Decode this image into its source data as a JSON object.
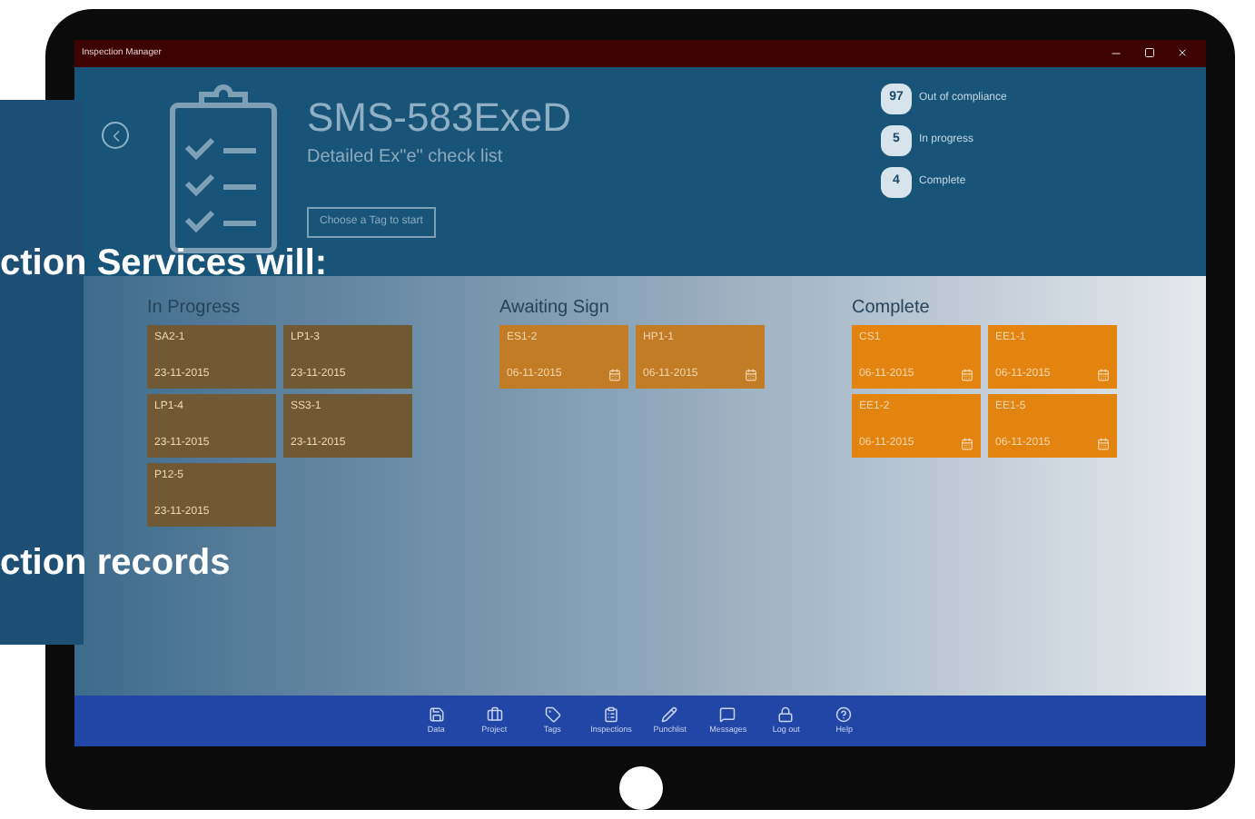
{
  "window": {
    "title": "Inspection Manager"
  },
  "header": {
    "title": "SMS-583ExeD",
    "subtitle": "Detailed Ex\"e\" check list",
    "button": "Choose a Tag to start"
  },
  "stats": [
    {
      "count": "97",
      "label": "Out of compliance"
    },
    {
      "count": "5",
      "label": "In progress"
    },
    {
      "count": "4",
      "label": "Complete"
    }
  ],
  "columns": [
    {
      "title": "In Progress",
      "kind": "in_progress",
      "tiles": [
        {
          "name": "SA2-1",
          "date": "23-11-2015"
        },
        {
          "name": "LP1-3",
          "date": "23-11-2015"
        },
        {
          "name": "LP1-4",
          "date": "23-11-2015"
        },
        {
          "name": "SS3-1",
          "date": "23-11-2015"
        },
        {
          "name": "P12-5",
          "date": "23-11-2015"
        }
      ]
    },
    {
      "title": "Awaiting Sign",
      "kind": "awaiting",
      "tiles": [
        {
          "name": "ES1-2",
          "date": "06-11-2015"
        },
        {
          "name": "HP1-1",
          "date": "06-11-2015"
        }
      ]
    },
    {
      "title": "Complete",
      "kind": "complete",
      "tiles": [
        {
          "name": "CS1",
          "date": "06-11-2015"
        },
        {
          "name": "EE1-1",
          "date": "06-11-2015"
        },
        {
          "name": "EE1-2",
          "date": "06-11-2015"
        },
        {
          "name": "EE1-5",
          "date": "06-11-2015"
        }
      ]
    }
  ],
  "nav": [
    {
      "label": "Data",
      "kind": "save"
    },
    {
      "label": "Project",
      "kind": "briefcase"
    },
    {
      "label": "Tags",
      "kind": "tag"
    },
    {
      "label": "Inspections",
      "kind": "clipboard"
    },
    {
      "label": "Punchlist",
      "kind": "pen"
    },
    {
      "label": "Messages",
      "kind": "message"
    },
    {
      "label": "Log out",
      "kind": "lock"
    },
    {
      "label": "Help",
      "kind": "help"
    }
  ],
  "overlay": {
    "lines": [
      "ction Services will:",
      "ction records"
    ]
  }
}
